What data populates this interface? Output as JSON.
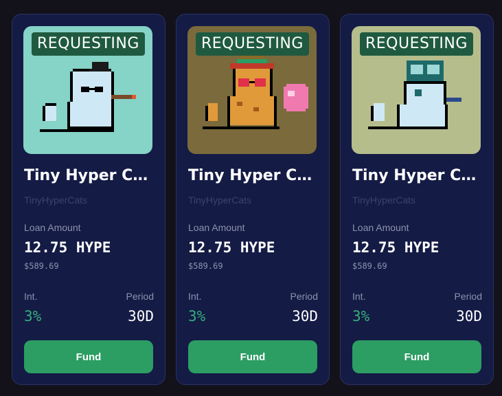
{
  "cards": [
    {
      "status": "REQUESTING",
      "name": "Tiny Hyper Cats",
      "collection": "TinyHyperCats",
      "loan_label": "Loan Amount",
      "loan_value": "12.75 HYPE",
      "loan_usd": "$589.69",
      "int_label": "Int.",
      "int_value": "3%",
      "period_label": "Period",
      "period_value": "30D",
      "fund_label": "Fund",
      "art_bg": "#86d3c8",
      "art_icon": "pixel-cat-top-hat-cigar"
    },
    {
      "status": "REQUESTING",
      "name": "Tiny Hyper Cats",
      "collection": "TinyHyperCats",
      "loan_label": "Loan Amount",
      "loan_value": "12.75 HYPE",
      "loan_usd": "$589.69",
      "int_label": "Int.",
      "int_value": "3%",
      "period_label": "Period",
      "period_value": "30D",
      "fund_label": "Fund",
      "art_bg": "#7a6a3c",
      "art_icon": "pixel-cat-sombrero-heart-glasses"
    },
    {
      "status": "REQUESTING",
      "name": "Tiny Hyper Cats",
      "collection": "TinyHyperCats",
      "loan_label": "Loan Amount",
      "loan_value": "12.75 HYPE",
      "loan_usd": "$589.69",
      "int_label": "Int.",
      "int_value": "3%",
      "period_label": "Period",
      "period_value": "30D",
      "fund_label": "Fund",
      "art_bg": "#b6bd8c",
      "art_icon": "pixel-cat-goggles-helmet"
    }
  ],
  "colors": {
    "page_bg": "#13111a",
    "card_bg": "#141b45",
    "accent_green": "#2c9d63",
    "interest_green": "#35b07a",
    "badge_bg": "#1f5a40"
  }
}
